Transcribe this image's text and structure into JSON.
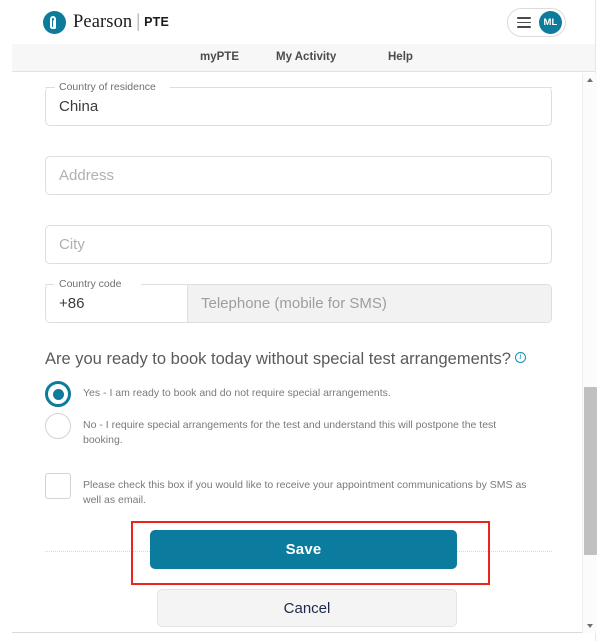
{
  "brand": {
    "logo_word": "Pearson",
    "logo_separator": "|",
    "logo_product": "PTE",
    "teal": "#0c7b9c"
  },
  "header": {
    "menu_icon": "hamburger-icon",
    "avatar_initials": "ML"
  },
  "nav": {
    "items": [
      {
        "label": "myPTE"
      },
      {
        "label": "My Activity"
      },
      {
        "label": "Help"
      }
    ]
  },
  "form": {
    "country": {
      "label": "Country of residence",
      "value": "China"
    },
    "address": {
      "placeholder": "Address",
      "value": ""
    },
    "city": {
      "placeholder": "City",
      "value": ""
    },
    "country_code": {
      "label": "Country code",
      "value": "+86"
    },
    "telephone": {
      "placeholder": "Telephone (mobile for SMS)",
      "value": ""
    }
  },
  "question": {
    "text": "Are you ready to book today without special test arrangements?",
    "info_icon": "info-circle-icon",
    "options": [
      {
        "label": "Yes - I am ready to book and do not require special arrangements.",
        "selected": true
      },
      {
        "label": "No - I require special arrangements for the test and understand this will postpone the test booking.",
        "selected": false
      }
    ]
  },
  "sms_consent": {
    "label": "Please check this box if you would like to receive your appointment communications by SMS as well as email.",
    "checked": false
  },
  "actions": {
    "save_label": "Save",
    "cancel_label": "Cancel",
    "save_color": "#0b7b9e",
    "highlight_color": "#e8261c"
  },
  "scrollbar": {
    "up_arrow": "triangle-up-icon",
    "down_arrow": "triangle-down-icon"
  }
}
